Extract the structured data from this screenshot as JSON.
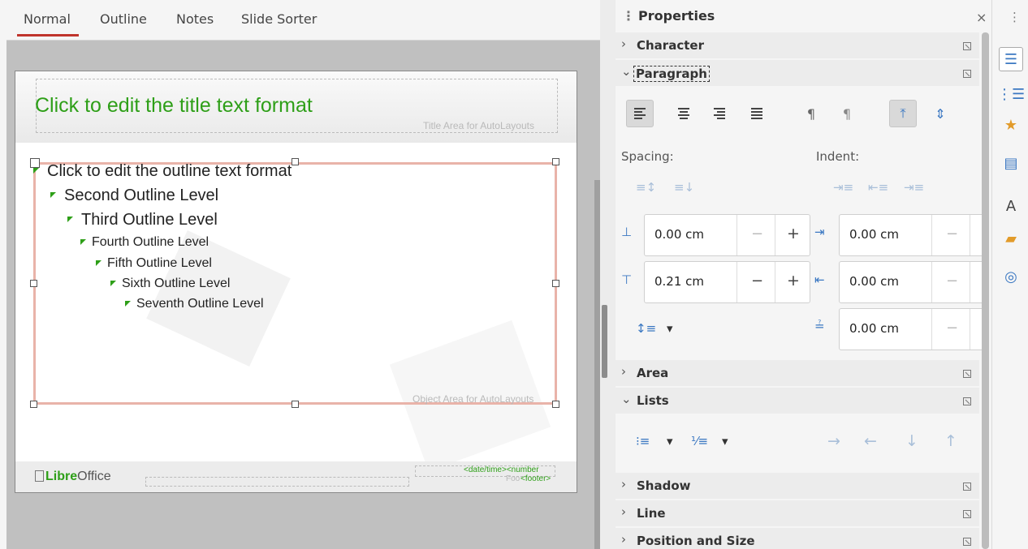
{
  "view_tabs": [
    "Normal",
    "Outline",
    "Notes",
    "Slide Sorter"
  ],
  "slide": {
    "title": "Click to edit the title text format",
    "title_area_label": "Title Area for AutoLayouts",
    "object_area_label": "Object Area for AutoLayouts",
    "outline": [
      "Click to edit the outline text format",
      "Second Outline Level",
      "Third Outline Level",
      "Fourth Outline Level",
      "Fifth Outline Level",
      "Sixth Outline Level",
      "Seventh Outline Level"
    ],
    "logo_bold": "Libre",
    "logo_rest": "Office",
    "footer_fields": {
      "datetime": "<date/time>",
      "number": "<number",
      "footer_prefix": "Foo",
      "footer": "<footer>"
    }
  },
  "properties": {
    "title": "Properties",
    "close": "×",
    "panels": {
      "character": "Character",
      "paragraph": "Paragraph",
      "area": "Area",
      "lists": "Lists",
      "shadow": "Shadow",
      "line": "Line",
      "position_size": "Position and Size"
    },
    "spacing_label": "Spacing:",
    "indent_label": "Indent:",
    "spacing": {
      "above": "0.00 cm",
      "below": "0.21 cm"
    },
    "indent": {
      "before": "0.00 cm",
      "after": "0.00 cm",
      "first_line": "0.00 cm"
    }
  },
  "sidebar_menu": "⋮"
}
